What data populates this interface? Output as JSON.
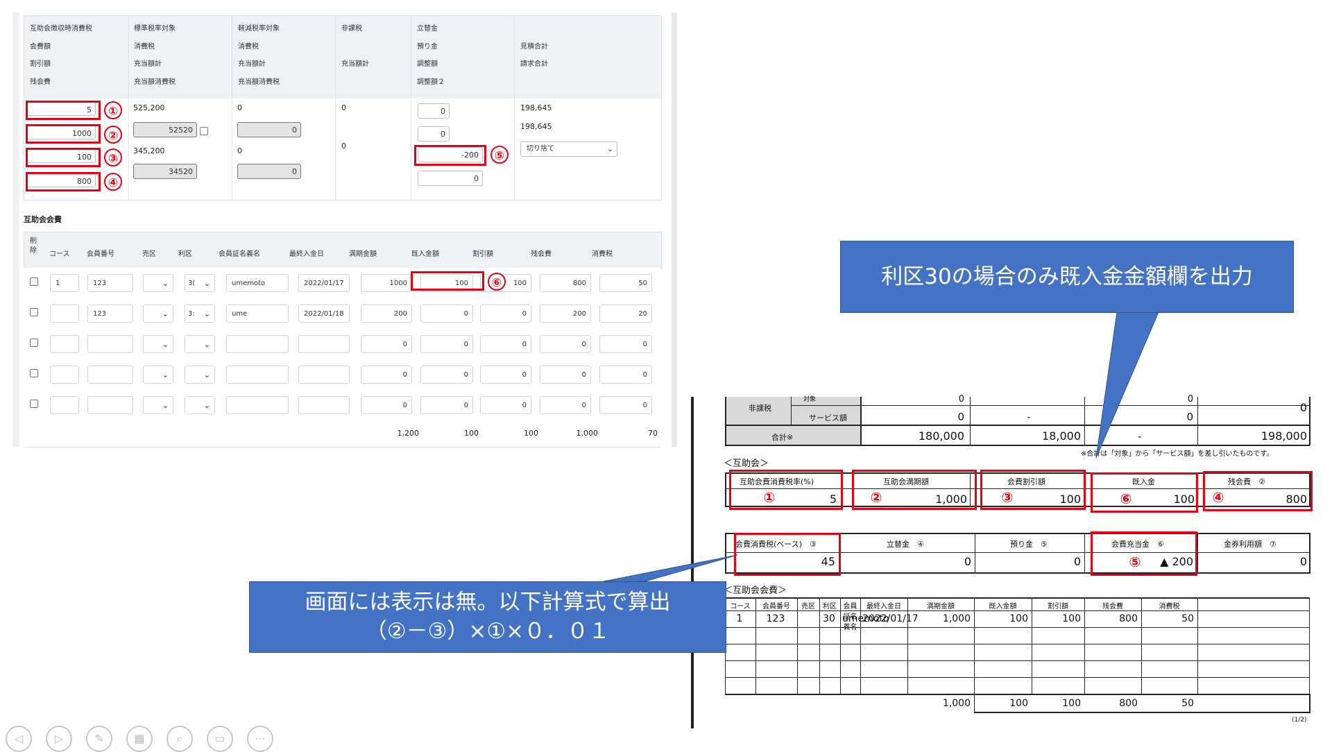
{
  "screen": {
    "header_cols": [
      [
        "互助会徴収時消費税",
        "会費額",
        "割引額",
        "残会費"
      ],
      [
        "標準税率対象",
        "消費税",
        "充当額計",
        "充当額消費税"
      ],
      [
        "軽減税率対象",
        "消費税",
        "充当額計",
        "充当額消費税"
      ],
      [
        "非課税",
        "",
        "充当額計",
        ""
      ],
      [
        "立替金",
        "預り金",
        "調整額",
        "調整額２"
      ],
      [
        "",
        "見積合計",
        "請求合計",
        ""
      ]
    ],
    "inputs": {
      "tax_rate": "5",
      "membership_fee": "1000",
      "discount": "100",
      "remaining_fee": "800",
      "std_target": "525,200",
      "std_applied": "52520",
      "std_total": "345,200",
      "std_applied_tax": "34520",
      "reduced_target": "0",
      "reduced_tax": "0",
      "reduced_total": "0",
      "reduced_applied_tax": "0",
      "nontax_target": "0",
      "nontax_total": "0",
      "advance": "0",
      "deposit": "0",
      "adjust": "-200",
      "adjust2": "0",
      "estimate_total": "198,645",
      "invoice_total": "198,645",
      "rounding": "切り捨て"
    },
    "section_title": "互助会会費",
    "table_headers": [
      "削除",
      "コース",
      "会員番号",
      "売区",
      "利区",
      "会員証名義名",
      "最終入金日",
      "満期金額",
      "既入金額",
      "割引額",
      "残会費",
      "消費税"
    ],
    "rows": [
      {
        "course": "1",
        "member_no": "123",
        "ri": "3(",
        "name": "umemoto",
        "last_date": "2022/01/17",
        "maturity": "1000",
        "paid": "100",
        "discount": "100",
        "remaining": "800",
        "tax": "50"
      },
      {
        "course": "",
        "member_no": "123",
        "ri": "3:",
        "name": "ume",
        "last_date": "2022/01/18",
        "maturity": "200",
        "paid": "0",
        "discount": "0",
        "remaining": "200",
        "tax": "20"
      },
      {
        "course": "",
        "member_no": "",
        "ri": "",
        "name": "",
        "last_date": "",
        "maturity": "0",
        "paid": "0",
        "discount": "0",
        "remaining": "0",
        "tax": "0"
      },
      {
        "course": "",
        "member_no": "",
        "ri": "",
        "name": "",
        "last_date": "",
        "maturity": "0",
        "paid": "0",
        "discount": "0",
        "remaining": "0",
        "tax": "0"
      },
      {
        "course": "",
        "member_no": "",
        "ri": "",
        "name": "",
        "last_date": "",
        "maturity": "0",
        "paid": "0",
        "discount": "0",
        "remaining": "0",
        "tax": "0"
      }
    ],
    "totals": {
      "maturity": "1,200",
      "paid": "100",
      "discount": "100",
      "remaining": "1,000",
      "tax": "70"
    }
  },
  "markers": [
    "①",
    "②",
    "③",
    "④",
    "⑤",
    "⑥"
  ],
  "report": {
    "top_rows": {
      "nontax_label": "非課税",
      "service_label": "サービス額",
      "partial_label": "対象",
      "sum_label": "合計※",
      "row0": [
        "0",
        "0",
        "0"
      ],
      "row1": [
        "0",
        "-",
        "0"
      ],
      "sum_row": [
        "180,000",
        "18,000",
        "-",
        "198,000"
      ],
      "note": "※合計は「対象」から「サービス額」を差し引いたものです。"
    },
    "gojokai_title": "＜互助会＞",
    "box1_labels": [
      "互助会費消費税率(%)",
      "互助会満期額",
      "会費割引額",
      "既入金",
      "残会費　②"
    ],
    "box1_values": [
      "5",
      "1,000",
      "100",
      "100",
      "800"
    ],
    "box2_labels": [
      "会費消費税(ベース)　③",
      "立替金　④",
      "預り金　⑤",
      "会費充当金　⑥",
      "金券利用額　⑦"
    ],
    "box2_values": [
      "45",
      "0",
      "0",
      "▲ 200",
      "0"
    ],
    "fee_title": "＜互助会会費＞",
    "fee_headers": [
      "コース",
      "会員番号",
      "売区",
      "利区",
      "会員証名義名",
      "最終入金日",
      "満期金額",
      "既入金額",
      "割引額",
      "残会費",
      "消費税"
    ],
    "fee_row": [
      "1",
      "123",
      "",
      "30",
      "umemoto",
      "2022/01/17",
      "1,000",
      "100",
      "100",
      "800",
      "50"
    ],
    "fee_totals": [
      "1,000",
      "100",
      "100",
      "800",
      "50"
    ],
    "page_no": "(1/2)"
  },
  "callouts": {
    "top": "利区30の場合のみ既入金金額欄を出力",
    "bottom_line1": "画面には表示は無。以下計算式で算出",
    "bottom_line2": "（②－③）×①×０．０１"
  },
  "colors": {
    "accent_red": "#e60012",
    "callout_blue": "#4472c4"
  }
}
